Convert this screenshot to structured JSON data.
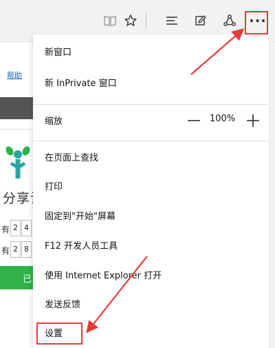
{
  "toolbar": {
    "icons": [
      "reading-view-icon",
      "favorite-star-icon",
      "hub-icon",
      "web-note-icon",
      "share-icon",
      "more-icon"
    ],
    "more_label": "···"
  },
  "page": {
    "help_link": "帮助",
    "slogan": "分享让",
    "rows": [
      {
        "label": "有",
        "digits": [
          "2",
          "4"
        ]
      },
      {
        "label": "有",
        "digits": [
          "2",
          "8"
        ]
      }
    ],
    "green_button_label": "已"
  },
  "menu": {
    "new_window": "新窗口",
    "new_inprivate": "新 InPrivate 窗口",
    "zoom_label": "缩放",
    "zoom_value": "100%",
    "find_on_page": "在页面上查找",
    "print": "打印",
    "pin_to_start": "固定到\"开始\"屏幕",
    "f12_tools": "F12 开发人员工具",
    "open_with_ie": "使用 Internet Explorer 打开",
    "send_feedback": "发送反馈",
    "settings": "设置"
  },
  "colors": {
    "annotation_red": "#e53a3a",
    "logo_green": "#2db34a",
    "logo_teal": "#27a7a0"
  }
}
